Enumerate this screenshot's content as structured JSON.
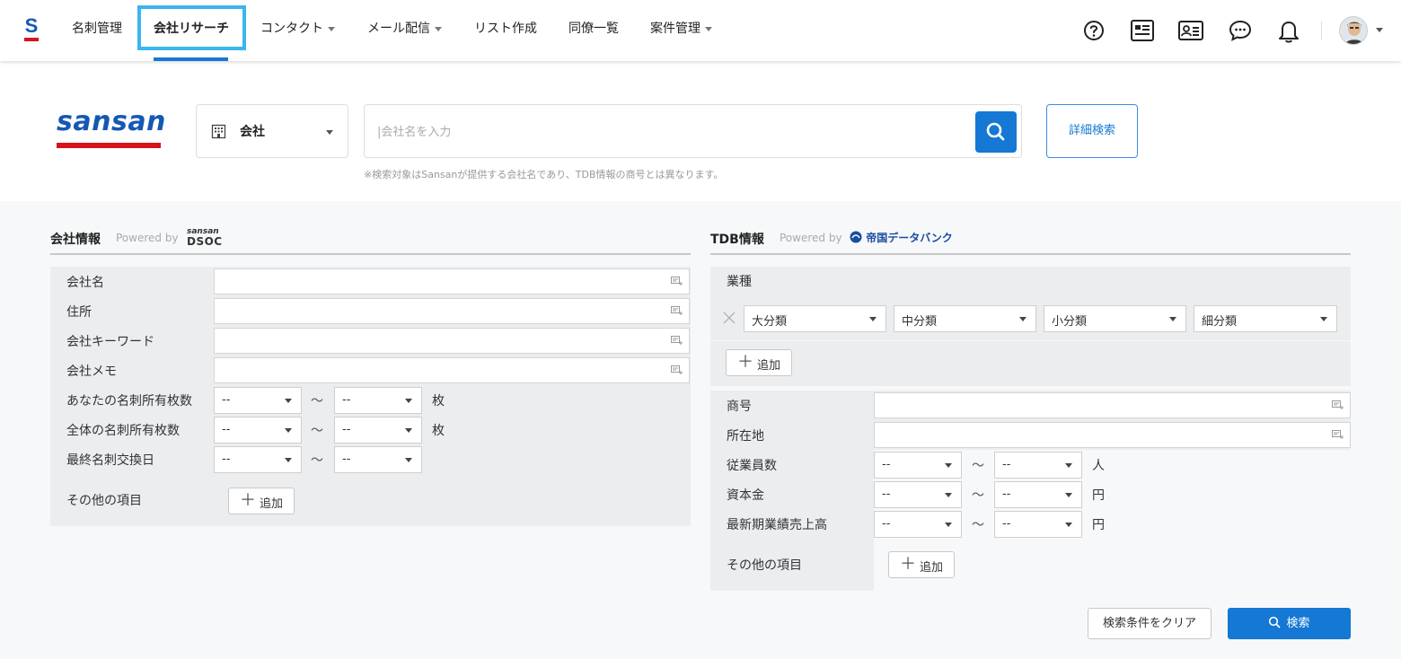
{
  "nav": {
    "brand_letter": "S",
    "items": [
      {
        "label": "名刺管理",
        "dropdown": false
      },
      {
        "label": "会社リサーチ",
        "dropdown": false,
        "active": true
      },
      {
        "label": "コンタクト",
        "dropdown": true
      },
      {
        "label": "メール配信",
        "dropdown": true
      },
      {
        "label": "リスト作成",
        "dropdown": false
      },
      {
        "label": "同僚一覧",
        "dropdown": false
      },
      {
        "label": "案件管理",
        "dropdown": true
      }
    ],
    "icons": [
      "help-icon",
      "news-icon",
      "contact-card-icon",
      "chat-icon",
      "bell-icon"
    ],
    "accent_color": "#1478d4",
    "highlight_color": "#39b6ee"
  },
  "search": {
    "logo_text": "sansan",
    "type_label": "会社",
    "placeholder": "|会社名を入力",
    "note": "※検索対象はSansanが提供する会社名であり、TDB情報の商号とは異なります。",
    "detail_button": "詳細検索"
  },
  "left_panel": {
    "title": "会社情報",
    "powered_by": "Powered by",
    "logo_small": "sansan",
    "logo_large": "DSOC",
    "text_rows": [
      {
        "label": "会社名"
      },
      {
        "label": "住所"
      },
      {
        "label": "会社キーワード"
      },
      {
        "label": "会社メモ"
      }
    ],
    "range_rows": [
      {
        "label": "あなたの名刺所有枚数",
        "from": "--",
        "to": "--",
        "unit": "枚"
      },
      {
        "label": "全体の名刺所有枚数",
        "from": "--",
        "to": "--",
        "unit": "枚"
      },
      {
        "label": "最終名刺交換日",
        "from": "--",
        "to": "--",
        "unit": ""
      }
    ],
    "tilde": "〜",
    "other_label": "その他の項目",
    "add_label": "追加"
  },
  "right_panel": {
    "title": "TDB情報",
    "powered_by": "Powered by",
    "logo_text": "帝国データバンク",
    "industry_label": "業種",
    "industry_selects": [
      "大分類",
      "中分類",
      "小分類",
      "細分類"
    ],
    "add_label": "追加",
    "text_rows": [
      {
        "label": "商号"
      },
      {
        "label": "所在地"
      }
    ],
    "range_rows": [
      {
        "label": "従業員数",
        "from": "--",
        "to": "--",
        "unit": "人"
      },
      {
        "label": "資本金",
        "from": "--",
        "to": "--",
        "unit": "円"
      },
      {
        "label": "最新期業績売上高",
        "from": "--",
        "to": "--",
        "unit": "円"
      }
    ],
    "tilde": "〜",
    "other_label": "その他の項目"
  },
  "actions": {
    "clear": "検索条件をクリア",
    "submit": "検索"
  }
}
